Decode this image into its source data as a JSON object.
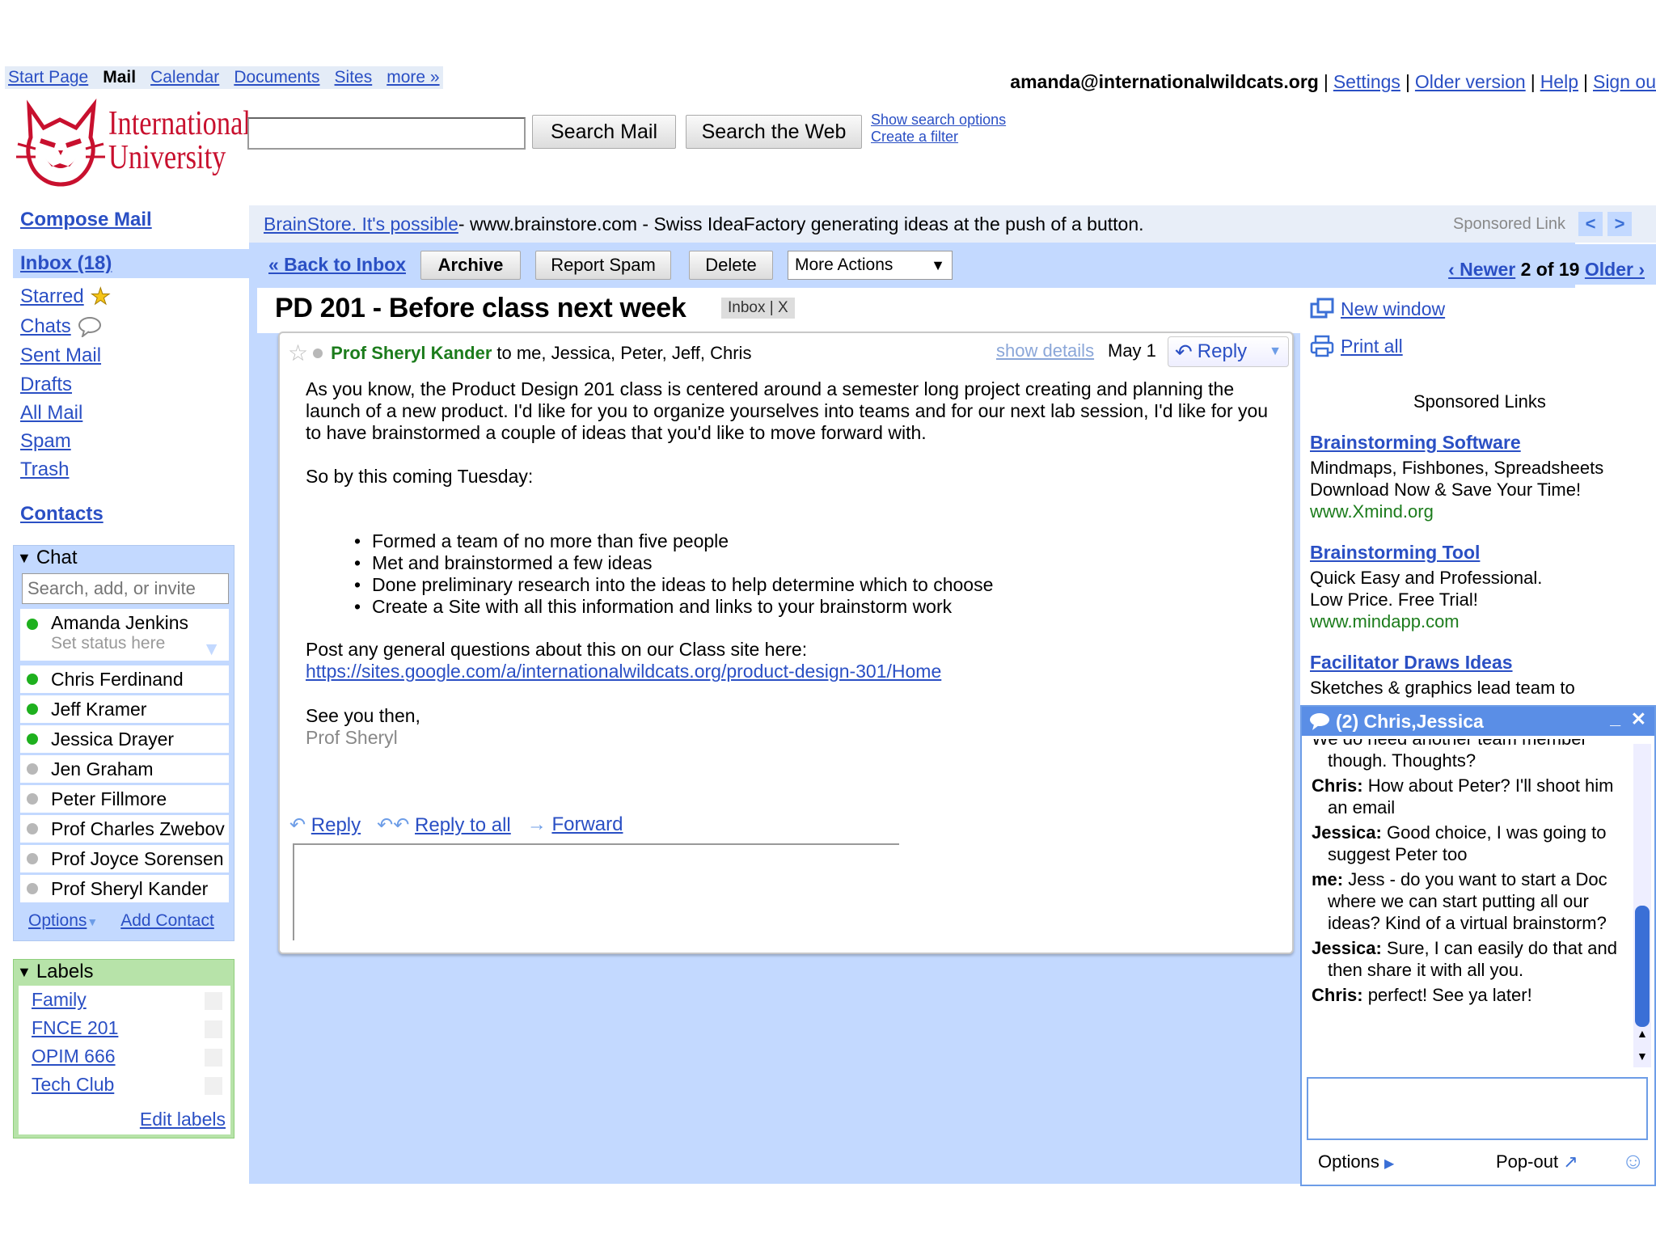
{
  "topnav": {
    "items": [
      "Start Page",
      "Mail",
      "Calendar",
      "Documents",
      "Sites",
      "more »"
    ],
    "current": "Mail"
  },
  "account": {
    "email": "amanda@internationalwildcats.org",
    "links": [
      "Settings",
      "Older version",
      "Help",
      "Sign ou"
    ]
  },
  "logo": {
    "line1": "International",
    "line2": "University"
  },
  "search": {
    "placeholder": "",
    "search_mail": "Search Mail",
    "search_web": "Search the Web",
    "show_options": "Show search options",
    "create_filter": "Create a filter"
  },
  "nav": {
    "compose": "Compose Mail",
    "inbox": "Inbox (18)",
    "starred": "Starred",
    "chats": "Chats",
    "sent": "Sent Mail",
    "drafts": "Drafts",
    "all": "All Mail",
    "spam": "Spam",
    "trash": "Trash",
    "contacts": "Contacts"
  },
  "chat": {
    "title": "Chat",
    "search_placeholder": "Search, add, or invite",
    "me": {
      "name": "Amanda Jenkins",
      "status": "Set status here"
    },
    "contacts": [
      {
        "name": "Chris Ferdinand",
        "online": true
      },
      {
        "name": "Jeff Kramer",
        "online": true
      },
      {
        "name": "Jessica Drayer",
        "online": true
      },
      {
        "name": "Jen Graham",
        "online": false
      },
      {
        "name": "Peter Fillmore",
        "online": false
      },
      {
        "name": "Prof Charles Zwebov",
        "online": false
      },
      {
        "name": "Prof Joyce Sorensen",
        "online": false
      },
      {
        "name": "Prof Sheryl Kander",
        "online": false
      }
    ],
    "options": "Options",
    "add_contact": "Add Contact"
  },
  "labels": {
    "title": "Labels",
    "items": [
      "Family",
      "FNCE 201",
      "OPIM 666",
      "Tech Club"
    ],
    "edit": "Edit labels"
  },
  "ad": {
    "link": "BrainStore. It's possible",
    "text": " - www.brainstore.com - Swiss IdeaFactory generating ideas at the push of a button.",
    "sponsored": "Sponsored Link"
  },
  "toolbar": {
    "back": "« Back to Inbox",
    "archive": "Archive",
    "report_spam": "Report Spam",
    "delete": "Delete",
    "more_actions": "More Actions",
    "newer": "‹ Newer",
    "position": "2 of 19",
    "older": "Older ›"
  },
  "message": {
    "subject": "PD 201 - Before class next week",
    "tag": "Inbox | X",
    "from": "Prof Sheryl Kander",
    "to": "to me, Jessica, Peter, Jeff, Chris",
    "show_details": "show details",
    "date": "May 1",
    "reply": "Reply",
    "para1": "As you know, the Product Design 201 class is centered around a semester long project creating and planning the launch of a new product. I'd like for you to organize yourselves into teams and for our next lab session, I'd like for you to have brainstormed a couple of ideas that you'd like to move forward with.",
    "para2": "So by this coming Tuesday:",
    "bullets": [
      "Formed a team of no more than five people",
      "Met and brainstormed a few ideas",
      "Done preliminary research into the ideas to help determine which to choose",
      "Create a Site with all this information and links to your brainstorm work"
    ],
    "para3": "Post any general questions about this on our Class site here:",
    "url": "https://sites.google.com/a/internationalwildcats.org/product-design-301/Home",
    "closing": "See you then,",
    "signature": "Prof Sheryl",
    "actions": {
      "reply": "Reply",
      "reply_all": "Reply to all",
      "forward": "Forward"
    }
  },
  "right": {
    "new_window": "New window",
    "print_all": "Print all",
    "sponsored": "Sponsored Links",
    "ads": [
      {
        "title": "Brainstorming Software",
        "lines": [
          "Mindmaps, Fishbones, Spreadsheets",
          "Download Now & Save Your Time!"
        ],
        "url": "www.Xmind.org"
      },
      {
        "title": "Brainstorming Tool",
        "lines": [
          "Quick Easy and Professional.",
          "Low Price. Free Trial!"
        ],
        "url": "www.mindapp.com"
      },
      {
        "title": "Facilitator Draws Ideas",
        "lines": [
          "Sketches & graphics lead team to"
        ],
        "url": ""
      }
    ]
  },
  "chatwin": {
    "title": "(2) Chris,Jessica",
    "messages": [
      {
        "who": "",
        "text": "We do need another team member though. Thoughts?"
      },
      {
        "who": "Chris:",
        "text": "How about Peter? I'll shoot him an email"
      },
      {
        "who": "Jessica:",
        "text": "Good choice, I was going to suggest Peter too"
      },
      {
        "who": "me:",
        "text": "Jess - do you want to start a Doc where we can start putting all our ideas? Kind of a virtual brainstorm?"
      },
      {
        "who": "Jessica:",
        "text": "Sure, I can easily do that and then share it with all you."
      },
      {
        "who": "Chris:",
        "text": "perfect! See ya later!"
      }
    ],
    "options": "Options",
    "popout": "Pop-out"
  },
  "colors": {
    "accent": "#c3d9ff",
    "link": "#2a4fc4",
    "labels": "#b7e3a9",
    "online": "#1eb01e",
    "chatbar": "#5a8ee6"
  }
}
